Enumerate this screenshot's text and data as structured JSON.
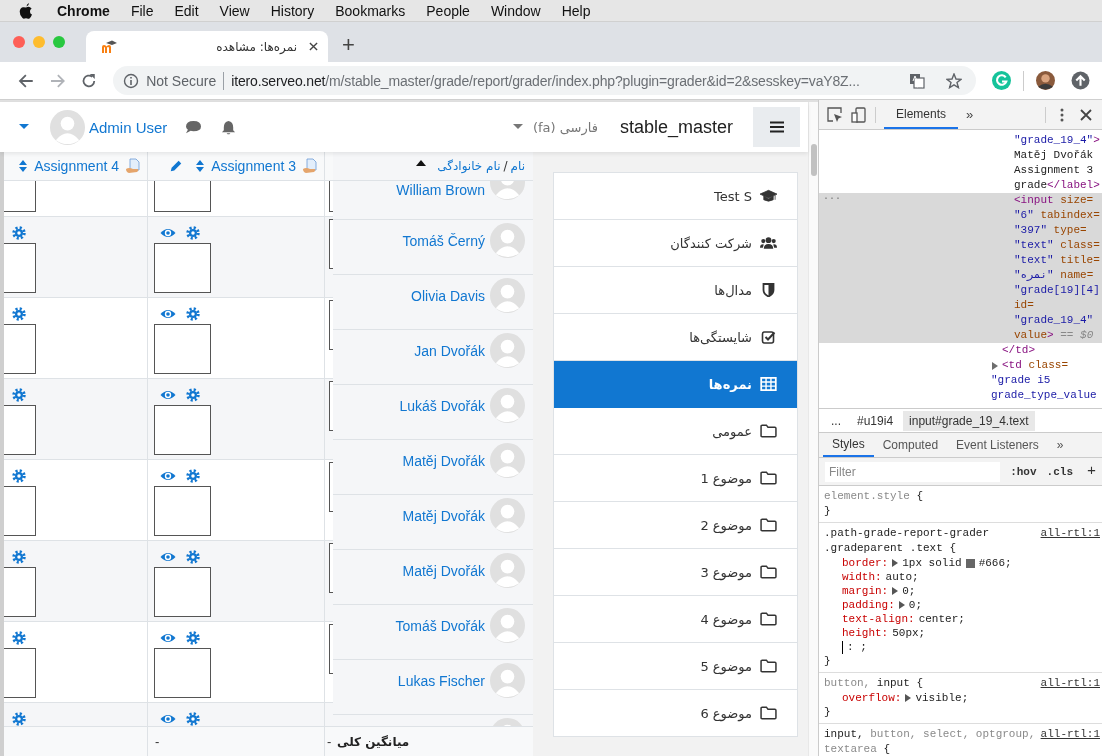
{
  "menubar": {
    "app": "Chrome",
    "items": [
      "File",
      "Edit",
      "View",
      "History",
      "Bookmarks",
      "People",
      "Window",
      "Help"
    ]
  },
  "tab": {
    "title": "نمره‌ها: مشاهده",
    "new_tab": "+"
  },
  "address_bar": {
    "security": "Not Secure",
    "host": "itero.serveo.net",
    "path": "/m/stable_master/grade/report/grader/index.php?plugin=grader&id=2&sesskey=vaY8Z..."
  },
  "navbar": {
    "user": "Admin User",
    "language": "فارسی (fa)",
    "site": "stable_master"
  },
  "grader": {
    "columns": [
      {
        "title": "Assignment 4",
        "edit_icon": false
      },
      {
        "title": "Assignment 3",
        "edit_icon": true
      }
    ],
    "name_header": {
      "first": "نام",
      "separator": "/",
      "last": "نام خانوادگی",
      "sort_ascending": true
    },
    "grade_rows": [
      {
        "kind": "partial-top"
      },
      {
        "kind": "full"
      },
      {
        "kind": "full"
      },
      {
        "kind": "full"
      },
      {
        "kind": "full"
      },
      {
        "kind": "full"
      },
      {
        "kind": "full"
      },
      {
        "kind": "partial-bottom"
      }
    ],
    "students": [
      {
        "kind": "partial-top",
        "name": "William Brown"
      },
      {
        "kind": "full",
        "name": "Tomáš Černý"
      },
      {
        "kind": "full",
        "name": "Olivia Davis"
      },
      {
        "kind": "full",
        "name": "Jan Dvořák"
      },
      {
        "kind": "full",
        "name": "Lukáš Dvořák"
      },
      {
        "kind": "full",
        "name": "Matěj Dvořák"
      },
      {
        "kind": "full",
        "name": "Matěj Dvořák"
      },
      {
        "kind": "full",
        "name": "Matěj Dvořák"
      },
      {
        "kind": "full",
        "name": "Tomáš Dvořák"
      },
      {
        "kind": "full",
        "name": "Lukas Fischer"
      },
      {
        "kind": "partial-bottom"
      }
    ],
    "footer": {
      "values": [
        "-",
        "-"
      ],
      "label": "میانگین کلی"
    }
  },
  "nav_drawer": [
    {
      "kind": "course",
      "label": "Test S",
      "selected": false
    },
    {
      "kind": "participants",
      "label": "شرکت کنندگان",
      "selected": false
    },
    {
      "kind": "badges",
      "label": "مدال‌ها",
      "selected": false
    },
    {
      "kind": "competencies",
      "label": "شایستگی‌ها",
      "selected": false
    },
    {
      "kind": "grades",
      "label": "نمره‌ها",
      "selected": true
    },
    {
      "kind": "section",
      "label": "عمومی",
      "selected": false
    },
    {
      "kind": "section",
      "label": "موضوع 1",
      "selected": false
    },
    {
      "kind": "section",
      "label": "موضوع 2",
      "selected": false
    },
    {
      "kind": "section",
      "label": "موضوع 3",
      "selected": false
    },
    {
      "kind": "section",
      "label": "موضوع 4",
      "selected": false
    },
    {
      "kind": "section",
      "label": "موضوع 5",
      "selected": false
    },
    {
      "kind": "section",
      "label": "موضوع 6",
      "selected": false
    }
  ],
  "devtools": {
    "panel_tab": "Elements",
    "more": "»",
    "dom": [
      {
        "children": [
          {
            "selected": false,
            "lines": [
              [
                {
                  "kind": "value",
                  "s": "\"grade_19_4\""
                },
                {
                  "kind": "tag",
                  "s": ">"
                }
              ],
              [
                {
                  "kind": "text",
                  "s": "Matěj Dvořák"
                }
              ],
              [
                {
                  "kind": "text",
                  "s": "Assignment 3"
                }
              ],
              [
                {
                  "kind": "text",
                  "s": "grade"
                },
                {
                  "kind": "tag",
                  "s": "</label>"
                }
              ]
            ]
          },
          {
            "selected": true,
            "gutter": "...",
            "lines": [
              [
                {
                  "kind": "tag",
                  "s": "<input"
                },
                {
                  "kind": "attr",
                  "s": " size="
                }
              ],
              [
                {
                  "kind": "value",
                  "s": "\"6\""
                },
                {
                  "kind": "attr",
                  "s": " tabindex="
                }
              ],
              [
                {
                  "kind": "value",
                  "s": "\"397\""
                },
                {
                  "kind": "attr",
                  "s": " type="
                }
              ],
              [
                {
                  "kind": "value",
                  "s": "\"text\""
                },
                {
                  "kind": "attr",
                  "s": " class="
                }
              ],
              [
                {
                  "kind": "value",
                  "s": "\"text\""
                },
                {
                  "kind": "attr",
                  "s": " title="
                }
              ],
              [
                {
                  "kind": "value",
                  "s": "\"نمره\""
                },
                {
                  "kind": "attr",
                  "s": " name="
                }
              ],
              [
                {
                  "kind": "value",
                  "s": "\"grade[19][4]"
                }
              ],
              [
                {
                  "kind": "attr",
                  "s": "id="
                }
              ],
              [
                {
                  "kind": "value",
                  "s": "\"grade_19_4\""
                }
              ],
              [
                {
                  "kind": "attr",
                  "s": "value"
                },
                {
                  "kind": "tag",
                  "s": ">"
                },
                {
                  "kind": "dim",
                  "s": " == $0"
                }
              ]
            ]
          }
        ],
        "closing": [
          {
            "kind": "tag",
            "s": "</td>"
          }
        ]
      },
      {
        "expanded": false,
        "lines": [
          [
            {
              "kind": "tag",
              "s": "<td"
            },
            {
              "kind": "attr",
              "s": " class="
            }
          ],
          [
            {
              "kind": "value",
              "s": "\"grade i5"
            }
          ],
          [
            {
              "kind": "value",
              "s": "grade_type_value"
            }
          ]
        ]
      }
    ],
    "breadcrumbs": [
      {
        "label": "...",
        "selected": false
      },
      {
        "label": "#u19i4",
        "selected": false
      },
      {
        "label": "input#grade_19_4.text",
        "selected": true
      }
    ],
    "style_tabs": [
      {
        "label": "Styles",
        "selected": true
      },
      {
        "label": "Computed",
        "selected": false
      },
      {
        "label": "Event Listeners",
        "selected": false
      }
    ],
    "style_tabs_more": "»",
    "filter": {
      "placeholder": "Filter",
      "hov": ":hov",
      "cls": ".cls",
      "add": "+"
    },
    "rules": [
      {
        "selector_lines": [
          [
            {
              "s": "element.style",
              "matched": false
            },
            {
              "s": " {",
              "matched": true
            }
          ]
        ],
        "close": "}"
      },
      {
        "source": "all-rtl:1",
        "selector_lines": [
          [
            {
              "s": ".path-grade-report-grader",
              "matched": true
            }
          ],
          [
            {
              "s": ".gradeparent .text {",
              "matched": true
            }
          ]
        ],
        "declarations": [
          {
            "kind": "decl",
            "property": "border:",
            "expandable": true,
            "value": "1px solid",
            "color": "#666666",
            "value_2": "#666;"
          },
          {
            "kind": "decl",
            "property": "width:",
            "expandable": false,
            "value": "auto;"
          },
          {
            "kind": "decl",
            "property": "margin:",
            "expandable": true,
            "value": "0;"
          },
          {
            "kind": "decl",
            "property": "padding:",
            "expandable": true,
            "value": "0;"
          },
          {
            "kind": "decl",
            "property": "text-align:",
            "expandable": false,
            "value": "center;"
          },
          {
            "kind": "decl",
            "property": "height:",
            "expandable": false,
            "value": "50px;"
          },
          {
            "kind": "editing",
            "text": ": ;"
          }
        ],
        "close": "}"
      },
      {
        "source": "all-rtl:1",
        "selector_lines": [
          [
            {
              "s": "button, ",
              "matched": false
            },
            {
              "s": "input",
              "matched": true
            },
            {
              "s": " {",
              "matched": true
            }
          ]
        ],
        "declarations": [
          {
            "kind": "decl",
            "property": "overflow:",
            "expandable": true,
            "value": "visible;"
          }
        ],
        "close": "}"
      },
      {
        "source": "all-rtl:1",
        "selector_lines": [
          [
            {
              "s": "input, ",
              "matched": true
            },
            {
              "s": "button, select, optgroup,",
              "matched": false
            }
          ],
          [
            {
              "s": "textarea",
              "matched": false
            },
            {
              "s": " {",
              "matched": true
            }
          ]
        ]
      }
    ]
  }
}
